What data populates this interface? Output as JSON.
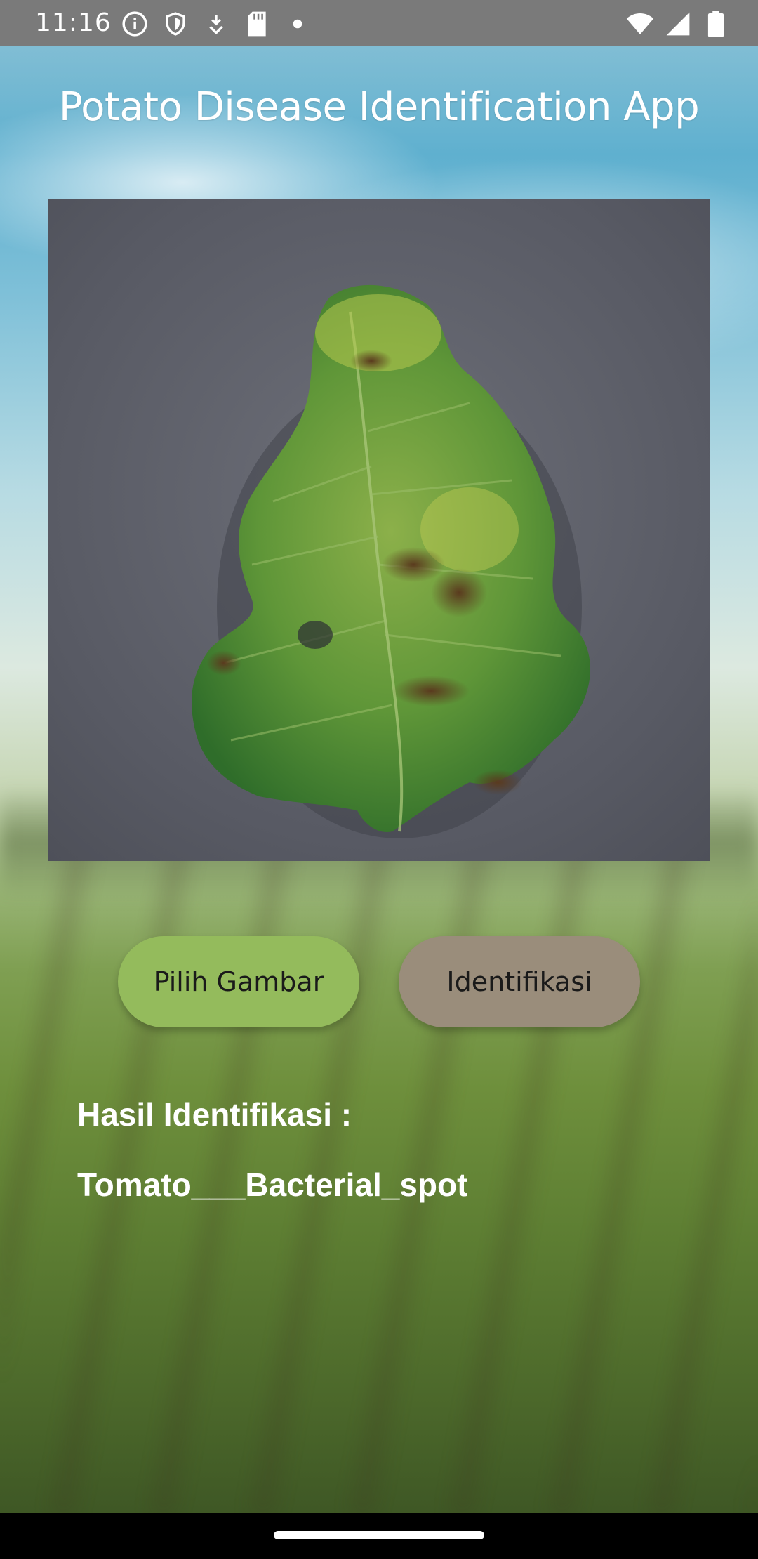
{
  "status_bar": {
    "time": "11:16",
    "left_icons": [
      "info-icon",
      "shield-icon",
      "download-icon",
      "sd-card-icon",
      "dot-icon"
    ],
    "right_icons": [
      "wifi-icon",
      "signal-icon",
      "battery-icon"
    ]
  },
  "header": {
    "title": "Potato Disease Identification App"
  },
  "preview": {
    "image_subject": "leaf-image"
  },
  "actions": {
    "pick_image_label": "Pilih Gambar",
    "identify_label": "Identifikasi",
    "pick_color": "#94bb5c",
    "identify_color": "#9a8d7b"
  },
  "result": {
    "label": "Hasil Identifikasi :",
    "value": "Tomato___Bacterial_spot"
  }
}
